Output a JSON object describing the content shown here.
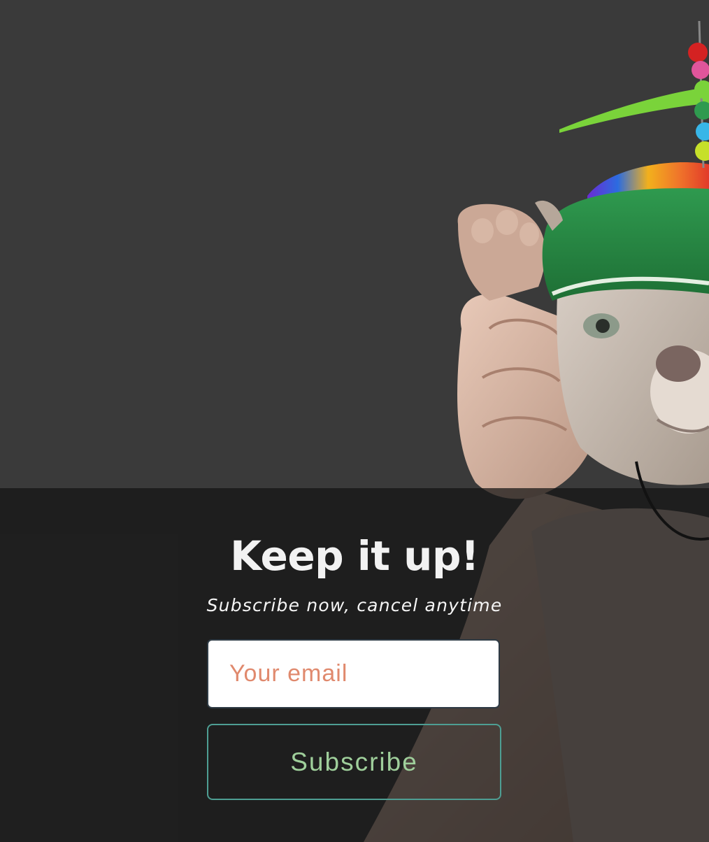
{
  "hero": {
    "image": "puppy-in-propeller-hat-photo",
    "background_color": "#3a3a3a"
  },
  "signup": {
    "headline": "Keep it up!",
    "subheadline": "Subscribe now, cancel anytime",
    "email_placeholder": "Your email",
    "email_value": "",
    "button_label": "Subscribe",
    "overlay_color": "#1a1a1a",
    "placeholder_color": "#e0896d",
    "button_text_color": "#9fcf9b",
    "button_border_color": "#4e9e93"
  }
}
